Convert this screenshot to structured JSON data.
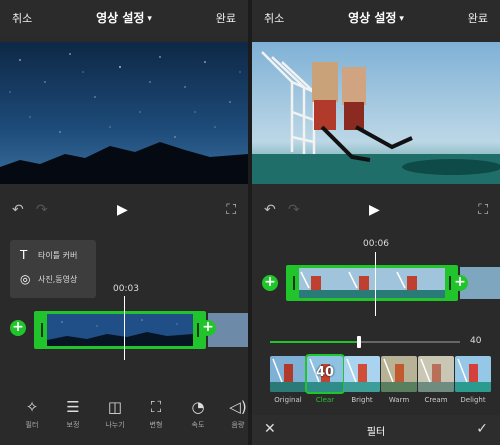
{
  "left": {
    "topbar": {
      "cancel": "취소",
      "title": "영상 설정",
      "done": "완료"
    },
    "popup": {
      "title_item": "타이틀 커버",
      "media_item": "사진,동영상"
    },
    "timecode": "00:03",
    "toolbar": [
      {
        "icon": "filter-icon",
        "label": "필터"
      },
      {
        "icon": "adjust-icon",
        "label": "보정"
      },
      {
        "icon": "split-icon",
        "label": "나누기"
      },
      {
        "icon": "transform-icon",
        "label": "변형"
      },
      {
        "icon": "speed-icon",
        "label": "속도"
      },
      {
        "icon": "volume-icon",
        "label": "음량"
      }
    ]
  },
  "right": {
    "topbar": {
      "cancel": "취소",
      "title": "영상 설정",
      "done": "완료"
    },
    "timecode": "00:06",
    "slider": {
      "value": "40",
      "fraction": 0.47
    },
    "filters": [
      {
        "label": "Original",
        "selected": false
      },
      {
        "label": "Clear",
        "selected": true,
        "value": "40"
      },
      {
        "label": "Bright",
        "selected": false
      },
      {
        "label": "Warm",
        "selected": false
      },
      {
        "label": "Cream",
        "selected": false
      },
      {
        "label": "Delight",
        "selected": false
      }
    ],
    "bottom_bar": {
      "label": "필터"
    }
  },
  "colors": {
    "accent": "#22c42c",
    "background": "#2a2a2a"
  }
}
